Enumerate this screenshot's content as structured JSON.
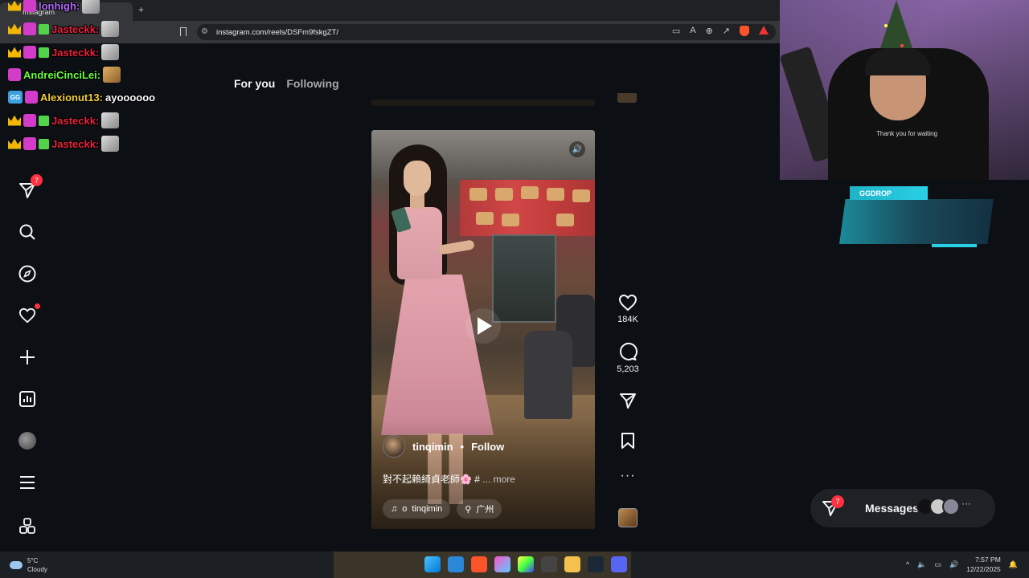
{
  "browser": {
    "tab_title": "Instagram",
    "url": "instagram.com/reels/DSFm9fskgZT/"
  },
  "instagram": {
    "feed_tabs": [
      "For you",
      "Following"
    ],
    "sidebar": {
      "direct_badge": "7",
      "items": [
        "instagram-logo",
        "direct",
        "search",
        "explore",
        "notifications",
        "create",
        "dashboard",
        "profile",
        "more",
        "also-from-meta"
      ]
    },
    "reel": {
      "author": "tinqimin",
      "separator": "•",
      "follow_label": "Follow",
      "caption": "對不起賴綺貞老師🌸 #",
      "caption_more": "... more",
      "audio_text": "o",
      "audio_author": "tinqimin",
      "location": "广州"
    },
    "actions": {
      "likes": "184K",
      "comments": "5,203"
    },
    "messages": {
      "label": "Messages",
      "badge": "7",
      "more": "···"
    }
  },
  "chat": [
    {
      "user": "lonhigh:",
      "color": "#b36cff",
      "message": ""
    },
    {
      "user": "Jasteckk:",
      "color": "#e8233c",
      "message": ""
    },
    {
      "user": "Jasteckk:",
      "color": "#e8233c",
      "message": ""
    },
    {
      "user": "AndreiCinciLei:",
      "color": "#6bff3a",
      "message": ""
    },
    {
      "user": "Alexionut13:",
      "color": "#f2d03a",
      "message": "ayoooooo"
    },
    {
      "user": "Jasteckk:",
      "color": "#e8233c",
      "message": ""
    },
    {
      "user": "Jasteckk:",
      "color": "#e8233c",
      "message": ""
    }
  ],
  "overlay": {
    "ggdrop_label": "GGDROP"
  },
  "webcam": {
    "shirt_text": "Thank you for waiting"
  },
  "taskbar": {
    "temperature": "5°C",
    "condition": "Cloudy",
    "time": "7:57 PM",
    "date": "12/22/2025"
  },
  "colors": {
    "page_bg": "#0c1014",
    "notification_red": "#ff3040",
    "accent_cyan": "#2ad0e6"
  }
}
